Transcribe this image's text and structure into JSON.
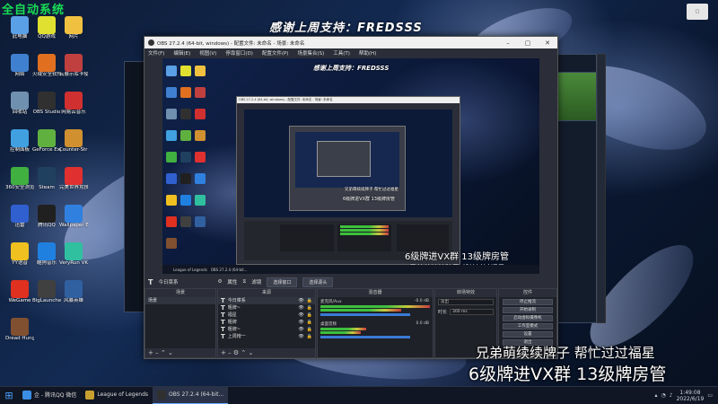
{
  "colors": {
    "accent": "#6aa7ff",
    "corner_green": "#1aff5a"
  },
  "overlay": {
    "corner": "全自动系统",
    "banner": "感谢上周支持：FREDSSS",
    "caption1": "兄弟萌续续牌子  帮忙过过福星",
    "caption2": "6级牌进VX群  13级牌房管"
  },
  "desktop_icons": [
    {
      "label": "此电脑",
      "color": "#5aa0e6"
    },
    {
      "label": "QQ游戏",
      "color": "#e0e030"
    },
    {
      "label": "网片",
      "color": "#f0c040"
    },
    {
      "label": "网络",
      "color": "#4080d0"
    },
    {
      "label": "火绒安全软件",
      "color": "#e07020"
    },
    {
      "label": "云展示库卡使用",
      "color": "#c04040"
    },
    {
      "label": "回收站",
      "color": "#7090b0"
    },
    {
      "label": "OBS Studio",
      "color": "#303030"
    },
    {
      "label": "网易云音乐",
      "color": "#d03030"
    },
    {
      "label": "控制面板",
      "color": "#40a0e0"
    },
    {
      "label": "GeForce Experience",
      "color": "#60b040"
    },
    {
      "label": "Counter-Strike",
      "color": "#d09030"
    },
    {
      "label": "360安全浏览器",
      "color": "#40b040"
    },
    {
      "label": "Steam",
      "color": "#204060"
    },
    {
      "label": "完美世界竞技平台",
      "color": "#e03030"
    },
    {
      "label": "迅雷",
      "color": "#3060d0"
    },
    {
      "label": "腾讯QQ",
      "color": "#202020"
    },
    {
      "label": "Wallpaper Engine",
      "color": "#3080e0"
    },
    {
      "label": "YY语音",
      "color": "#f0c020"
    },
    {
      "label": "酷狗音乐",
      "color": "#2080e0"
    },
    {
      "label": "VeryRun VK",
      "color": "#30c0a0"
    },
    {
      "label": "WeGame",
      "color": "#e03020"
    },
    {
      "label": "BigLauncher",
      "color": "#404040"
    },
    {
      "label": "风暴英雄",
      "color": "#3060a0"
    },
    {
      "label": "Dread Hunger",
      "color": "#805030"
    }
  ],
  "obs": {
    "title": "OBS 27.2.4 (64-bit, windows) - 配置文件: 未命名 - 场景: 未命名",
    "menu": [
      "文件(F)",
      "编辑(E)",
      "视图(V)",
      "停靠窗口(D)",
      "配置文件(P)",
      "场景集合(S)",
      "工具(T)",
      "帮助(H)"
    ],
    "toolbar": {
      "source_name": "今日菜系",
      "props": "属性",
      "filters": "滤镜",
      "window_label": "选择窗口",
      "select_label": "选择窗口",
      "window_btn": "选择窗口",
      "select_btn": "选择源头"
    },
    "docks": {
      "scenes": {
        "title": "场景",
        "items": [
          "场景"
        ]
      },
      "sources": {
        "title": "来源",
        "items": [
          "今日菜系",
          "粗牌~",
          "福星",
          "粗牌",
          "粗牌~",
          "上周榜一"
        ]
      },
      "mixer": {
        "title": "混音器",
        "tracks": [
          {
            "name": "麦克风/Aux",
            "db": "-0.0 dB"
          },
          {
            "name": "桌面音频",
            "db": "0.0 dB"
          }
        ]
      },
      "transitions": {
        "title": "转场特效",
        "type": "淡出",
        "duration_label": "时长",
        "duration": "300 ms"
      },
      "controls": {
        "title": "控件",
        "buttons": [
          "停止推流",
          "开始录制",
          "启动虚拟摄像机",
          "工作室模式",
          "设置",
          "退出"
        ]
      }
    }
  },
  "taskbar": {
    "apps": [
      {
        "label": "企 - 腾讯QQ 微信",
        "color": "#3a8ee6"
      },
      {
        "label": "League of Legends",
        "color": "#c8a030"
      },
      {
        "label": "OBS 27.2.4 (64-bit...",
        "color": "#303030"
      }
    ],
    "time": "1:49:08",
    "date": "2022/6/19"
  }
}
